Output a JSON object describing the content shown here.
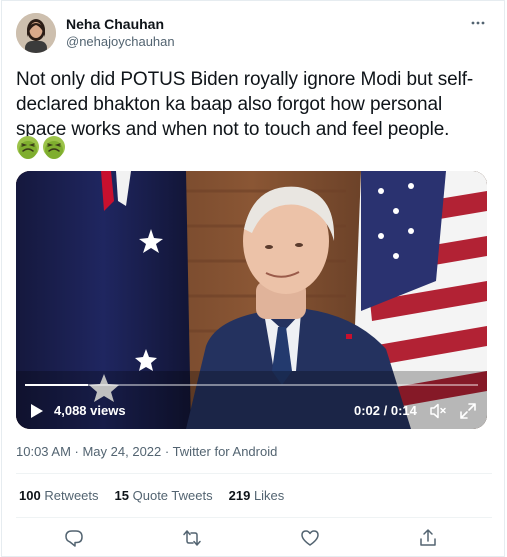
{
  "tweet": {
    "author_name": "Neha Chauhan",
    "author_handle": "@nehajoychauhan",
    "text": "Not only did POTUS Biden royally ignore Modi but self-declared bhakton ka baap also forgot how personal space works and when not to touch and feel people.",
    "emojis": [
      "nauseated-face-icon",
      "nauseated-face-icon"
    ],
    "timestamp": "10:03 AM · May 24, 2022 · Twitter for Android"
  },
  "video": {
    "views": "4,088 views",
    "time": "0:02 / 0:14",
    "progress": 0.14
  },
  "stats": {
    "retweets_count": "100",
    "retweets_label": "Retweets",
    "quotes_count": "15",
    "quotes_label": "Quote Tweets",
    "likes_count": "219",
    "likes_label": "Likes"
  },
  "colors": {
    "text": "#0f1419",
    "secondary": "#536471",
    "divider": "#eff3f4",
    "background": "#ffffff"
  },
  "icons": [
    "more-icon",
    "play-icon",
    "mute-icon",
    "expand-icon",
    "reply-icon",
    "retweet-icon",
    "like-icon",
    "share-icon"
  ]
}
